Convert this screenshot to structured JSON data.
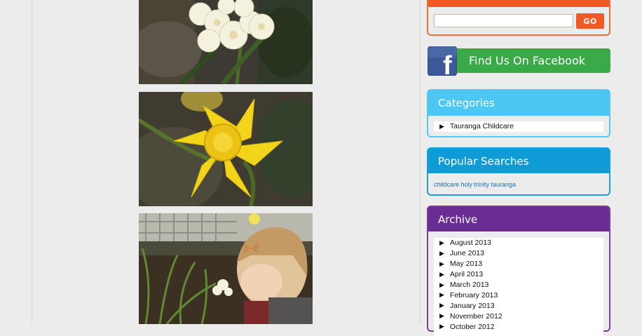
{
  "search": {
    "value": "",
    "go_label": "GO"
  },
  "facebook": {
    "label": "Find Us On Facebook",
    "logo_text": "f"
  },
  "categories": {
    "title": "Categories",
    "items": [
      "Tauranga Childcare"
    ]
  },
  "popular_searches": {
    "title": "Popular Searches",
    "link": "childcare holy trinity tauranga"
  },
  "archive": {
    "title": "Archive",
    "items": [
      "August 2013",
      "June 2013",
      "May 2013",
      "April 2013",
      "March 2013",
      "February 2013",
      "January 2013",
      "November 2012",
      "October 2012"
    ]
  },
  "colors": {
    "search_accent": "#f15a24",
    "facebook_green": "#3aa948",
    "facebook_blue": "#3b5998",
    "categories_blue": "#4cc6f2",
    "popular_blue": "#0e9bd6",
    "archive_purple": "#6a2d93"
  }
}
